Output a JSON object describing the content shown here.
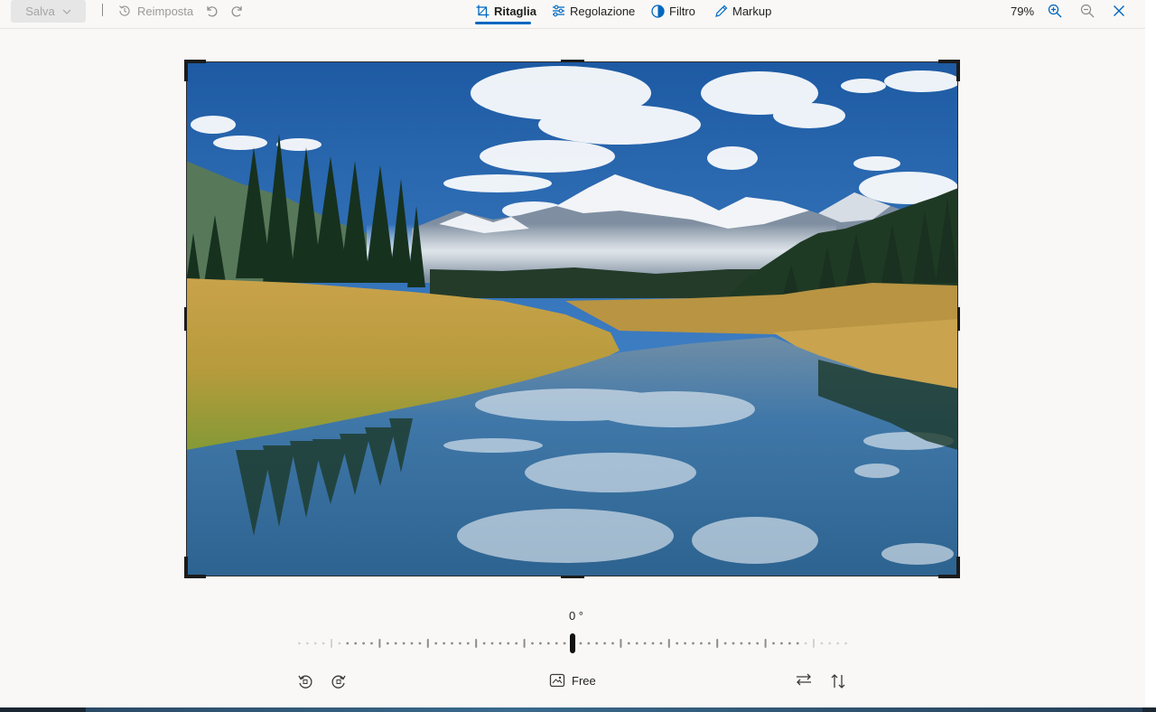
{
  "toolbar": {
    "save_label": "Salva",
    "reset_label": "Reimposta",
    "tabs": [
      {
        "label": "Ritaglia",
        "icon": "crop-icon",
        "active": true
      },
      {
        "label": "Regolazione",
        "icon": "adjust-sliders-icon",
        "active": false
      },
      {
        "label": "Filtro",
        "icon": "filter-icon",
        "active": false
      },
      {
        "label": "Markup",
        "icon": "pen-icon",
        "active": false
      }
    ],
    "zoom_level": "79%"
  },
  "editor": {
    "rotation_angle": "0 °",
    "rotation_value": 0,
    "aspect_label": "Free"
  },
  "colors": {
    "accent": "#0067c0",
    "background": "#f9f8f7"
  }
}
